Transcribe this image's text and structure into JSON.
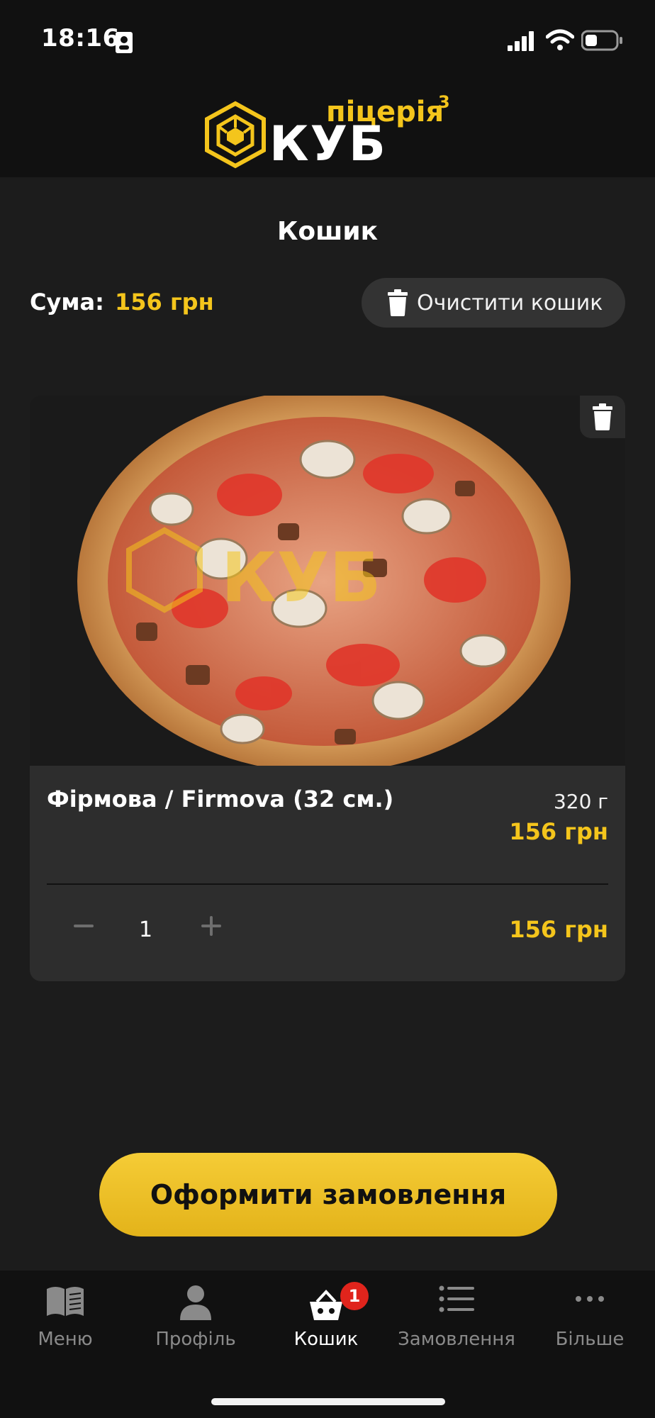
{
  "status_bar": {
    "time": "18:16"
  },
  "brand": {
    "wordmark": "КУБ",
    "subtitle": "піцерія",
    "superscript": "3"
  },
  "cart": {
    "title": "Кошик",
    "sum_label": "Сума:",
    "sum_value": "156 грн",
    "clear_label": "Очистити кошик"
  },
  "item": {
    "name": "Фірмова / Firmova (32 см.)",
    "weight": "320 г",
    "price": "156 грн",
    "quantity": "1",
    "line_total": "156 грн"
  },
  "checkout_label": "Оформити замовлення",
  "tabs": [
    {
      "label": "Меню",
      "icon": "book-icon"
    },
    {
      "label": "Профіль",
      "icon": "person-icon"
    },
    {
      "label": "Кошик",
      "icon": "basket-icon",
      "badge": "1",
      "active": true
    },
    {
      "label": "Замовлення",
      "icon": "list-icon"
    },
    {
      "label": "Більше",
      "icon": "more-icon"
    }
  ],
  "colors": {
    "accent": "#f4c51c",
    "badge": "#e0241c",
    "background": "#1c1c1c"
  }
}
